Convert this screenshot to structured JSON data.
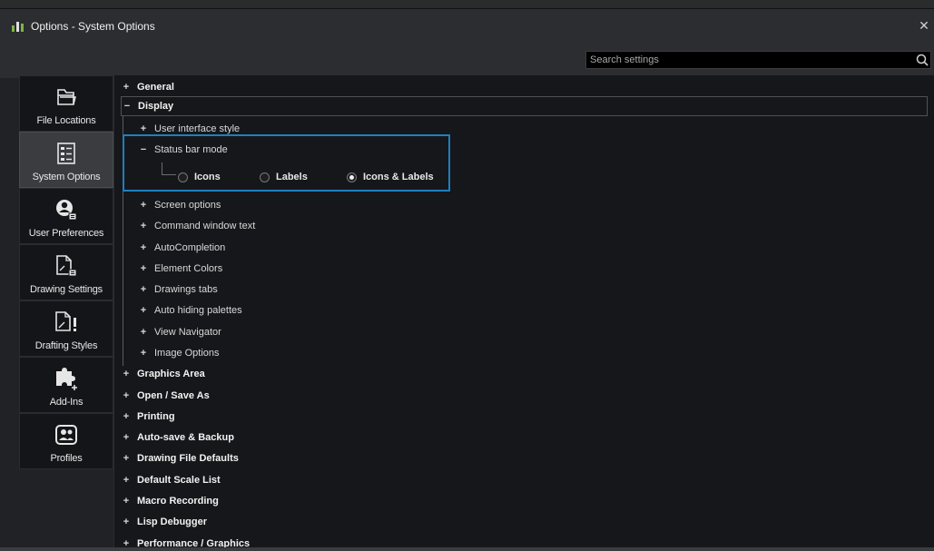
{
  "window": {
    "title": "Options - System Options",
    "close_glyph": "✕"
  },
  "search": {
    "placeholder": "Search settings"
  },
  "sidebar": {
    "items": [
      {
        "label": "File Locations",
        "icon": "folder-icon"
      },
      {
        "label": "System Options",
        "icon": "list-options-icon",
        "active": true
      },
      {
        "label": "User Preferences",
        "icon": "user-preferences-icon"
      },
      {
        "label": "Drawing Settings",
        "icon": "drawing-settings-icon"
      },
      {
        "label": "Drafting Styles",
        "icon": "drafting-styles-icon"
      },
      {
        "label": "Add-Ins",
        "icon": "puzzle-icon"
      },
      {
        "label": "Profiles",
        "icon": "profiles-icon"
      }
    ]
  },
  "tree": {
    "expand": "+",
    "collapse": "−",
    "general": "General",
    "display": "Display",
    "display_children": {
      "user_interface_style": "User interface style",
      "status_bar_mode": "Status bar mode",
      "screen_options": "Screen options",
      "command_window_text": "Command window text",
      "autocompletion": "AutoCompletion",
      "element_colors": "Element Colors",
      "drawings_tabs": "Drawings tabs",
      "auto_hiding_palettes": "Auto hiding palettes",
      "view_navigator": "View Navigator",
      "image_options": "Image Options"
    },
    "status_bar_options": {
      "icons": "Icons",
      "labels": "Labels",
      "icons_labels": "Icons & Labels",
      "selected": "Icons & Labels"
    },
    "graphics_area": "Graphics Area",
    "open_save_as": "Open / Save As",
    "printing": "Printing",
    "autosave_backup": "Auto-save & Backup",
    "drawing_file_defaults": "Drawing File Defaults",
    "default_scale_list": "Default Scale List",
    "macro_recording": "Macro Recording",
    "lisp_debugger": "Lisp Debugger",
    "performance_graphics": "Performance / Graphics"
  },
  "colors": {
    "highlight": "#1e7fc0",
    "background": "#16171a",
    "active_nav": "#3a3c40"
  }
}
